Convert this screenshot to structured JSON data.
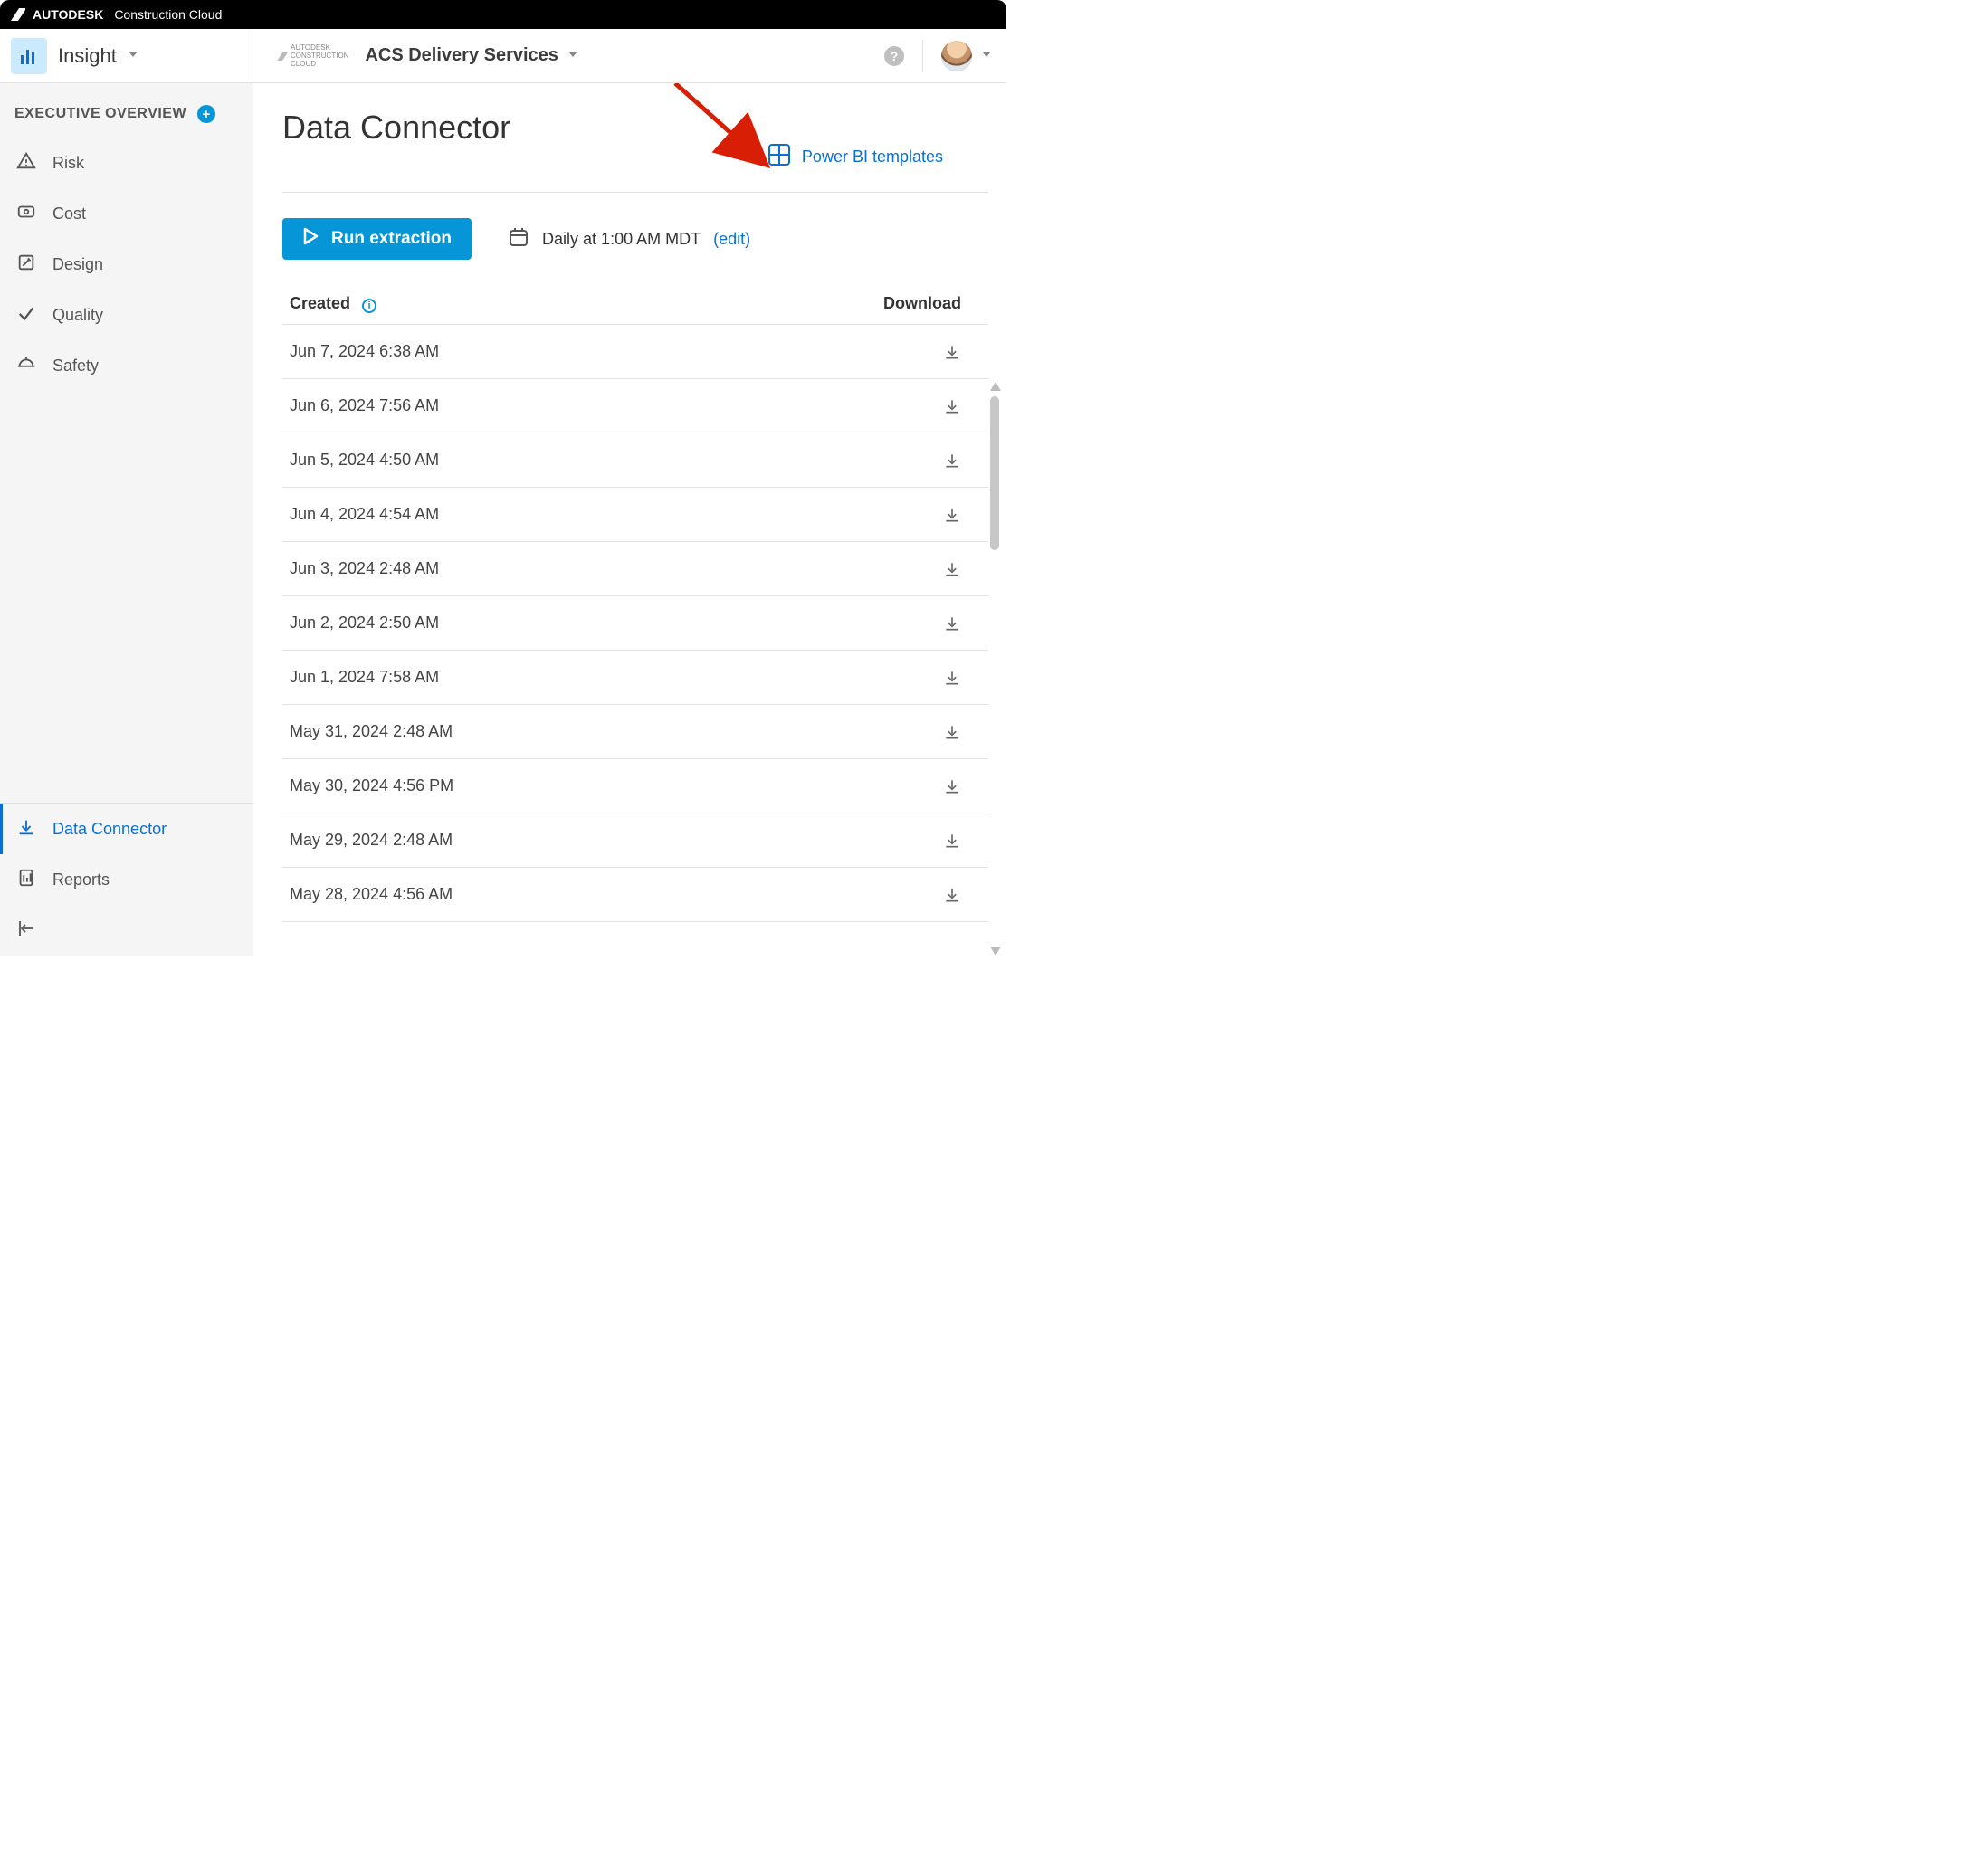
{
  "brand": {
    "company": "AUTODESK",
    "product": "Construction Cloud"
  },
  "header": {
    "tool": "Insight",
    "account_badge": "AUTODESK CONSTRUCTION CLOUD",
    "account": "ACS Delivery Services"
  },
  "sidebar": {
    "section_title": "EXECUTIVE OVERVIEW",
    "items": [
      {
        "label": "Risk"
      },
      {
        "label": "Cost"
      },
      {
        "label": "Design"
      },
      {
        "label": "Quality"
      },
      {
        "label": "Safety"
      }
    ],
    "bottom_items": [
      {
        "label": "Data Connector",
        "active": true
      },
      {
        "label": "Reports",
        "active": false
      }
    ]
  },
  "page": {
    "title": "Data Connector",
    "powerbi_link": "Power BI templates",
    "run_button": "Run extraction",
    "schedule_text": "Daily at 1:00 AM MDT",
    "schedule_edit": "(edit)",
    "columns": {
      "created": "Created",
      "download": "Download"
    },
    "rows": [
      {
        "created": "Jun 7, 2024 6:38 AM"
      },
      {
        "created": "Jun 6, 2024 7:56 AM"
      },
      {
        "created": "Jun 5, 2024 4:50 AM"
      },
      {
        "created": "Jun 4, 2024 4:54 AM"
      },
      {
        "created": "Jun 3, 2024 2:48 AM"
      },
      {
        "created": "Jun 2, 2024 2:50 AM"
      },
      {
        "created": "Jun 1, 2024 7:58 AM"
      },
      {
        "created": "May 31, 2024 2:48 AM"
      },
      {
        "created": "May 30, 2024 4:56 PM"
      },
      {
        "created": "May 29, 2024 2:48 AM"
      },
      {
        "created": "May 28, 2024 4:56 AM"
      }
    ]
  }
}
